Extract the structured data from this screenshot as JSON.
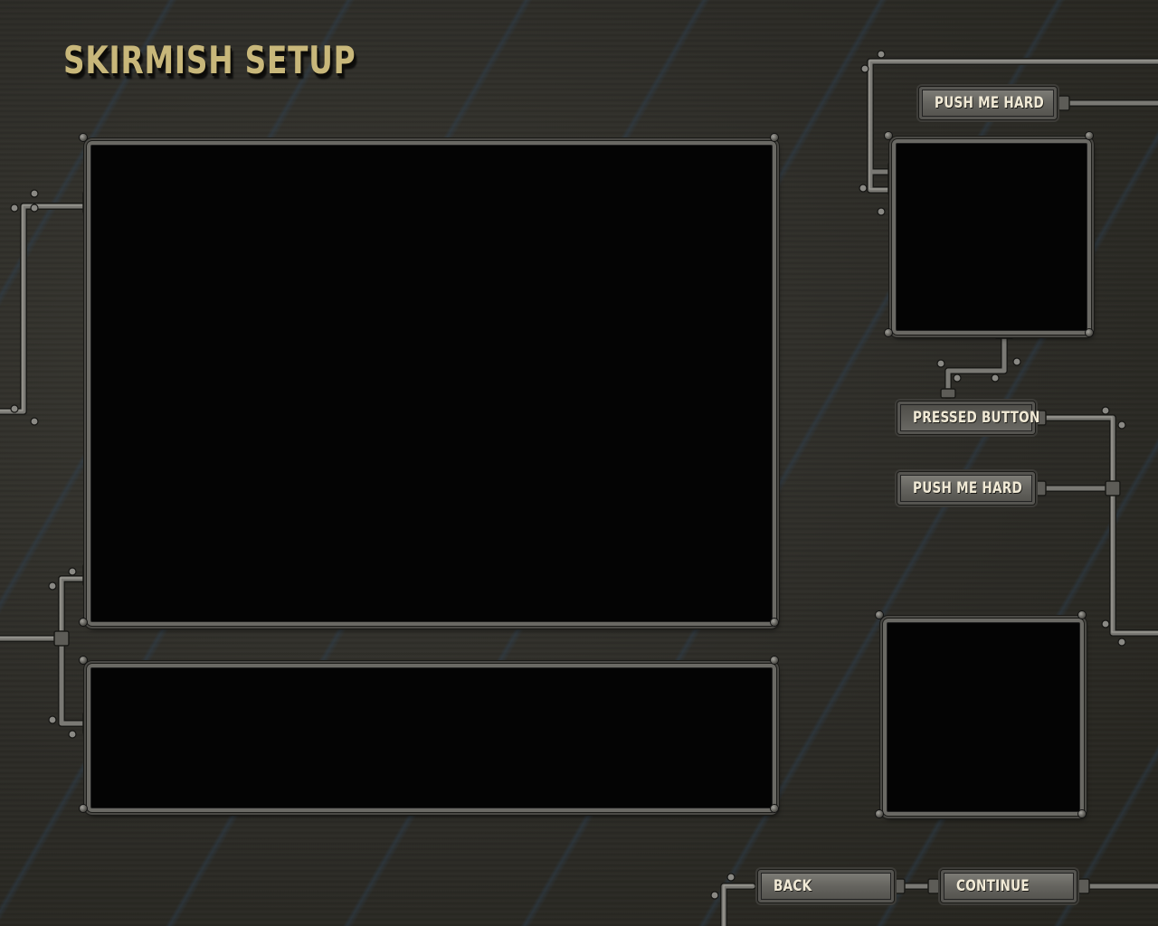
{
  "screen": {
    "title": "SKIRMISH SETUP"
  },
  "buttons": {
    "push_top": "PUSH ME HARD",
    "pressed": "PRESSED BUTTON",
    "push_mid": "PUSH ME HARD",
    "back": "BACK",
    "continue": "CONTINUE"
  },
  "colors": {
    "title": "#c8b77a",
    "panel_bg": "#040404",
    "pipe": "#7a7974",
    "button_text": "#f1ead6"
  }
}
